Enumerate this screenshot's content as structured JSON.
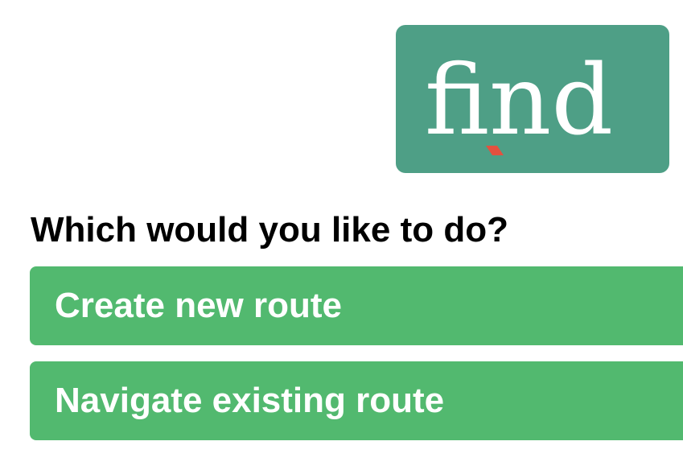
{
  "logo": {
    "text": "find",
    "background_color": "#4e9f86",
    "text_color": "#ffffff",
    "accent_color": "#e4513f"
  },
  "prompt": {
    "question": "Which would you like to do?"
  },
  "options": {
    "create_label": "Create new route",
    "navigate_label": "Navigate existing route",
    "button_color": "#52b96f"
  }
}
